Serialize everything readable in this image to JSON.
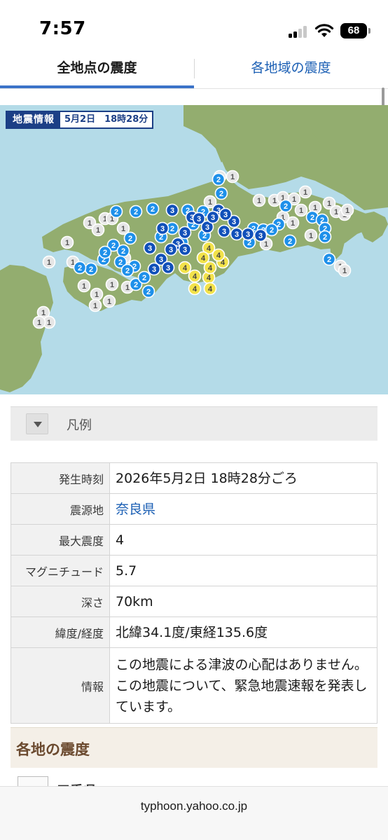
{
  "status_bar": {
    "time": "7:57",
    "battery": "68"
  },
  "tabs": [
    {
      "label": "全地点の震度",
      "active": true
    },
    {
      "label": "各地域の震度",
      "active": false
    }
  ],
  "map": {
    "label_title": "地震情報",
    "label_date": "5月2日　18時28分"
  },
  "legend": {
    "label": "凡例"
  },
  "info": {
    "rows": [
      {
        "key": "発生時刻",
        "value": "2026年5月2日 18時28分ごろ"
      },
      {
        "key": "震源地",
        "value": "奈良県"
      },
      {
        "key": "最大震度",
        "value": "4"
      },
      {
        "key": "マグニチュード",
        "value": "5.7"
      },
      {
        "key": "深さ",
        "value": "70km"
      },
      {
        "key": "緯度/経度",
        "value": "北緯34.1度/東経135.6度"
      },
      {
        "key": "情報",
        "value": "この地震による津波の心配はありません。この地震について、緊急地震速報を発表しています。"
      }
    ]
  },
  "section": {
    "title": "各地の震度",
    "first_region": "三重県"
  },
  "browser": {
    "url": "typhoon.yahoo.co.jp"
  },
  "colors": {
    "intensity_1": "#e6e6e6",
    "intensity_2": "#1e90ea",
    "intensity_3": "#1150b9",
    "intensity_4": "#f2e24a",
    "land": "#93ad6f",
    "sea": "#b4dbe8",
    "tab_accent": "#3b73c8"
  }
}
